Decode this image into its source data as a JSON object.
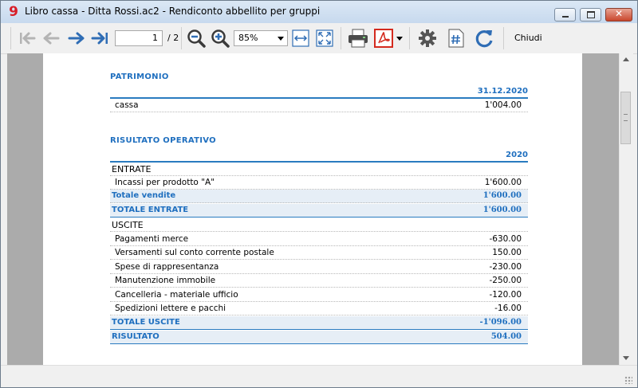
{
  "window": {
    "title": "Libro cassa - Ditta Rossi.ac2 - Rendiconto abbellito per gruppi",
    "app_icon_glyph": "9",
    "close_glyph": "✕"
  },
  "toolbar": {
    "current_page": "1",
    "page_total": "/ 2",
    "zoom": "85%",
    "close_label": "Chiudi",
    "icons": [
      "first-page-icon",
      "previous-page-icon",
      "next-page-icon",
      "last-page-icon",
      "zoom-out-icon",
      "zoom-in-icon",
      "fit-width-icon",
      "fit-page-icon",
      "print-icon",
      "pdf-icon",
      "settings-icon",
      "page-number-icon",
      "refresh-icon"
    ]
  },
  "report": {
    "patrimonio": {
      "title": "PATRIMONIO",
      "column_header": "31.12.2020",
      "rows": [
        {
          "label": "cassa",
          "amount": "1'004.00"
        }
      ]
    },
    "risultato": {
      "title": "RISULTATO OPERATIVO",
      "column_header": "2020",
      "entrate_label": "ENTRATE",
      "entrate_rows": [
        {
          "label": "Incassi per prodotto \"A\"",
          "amount": "1'600.00"
        }
      ],
      "totale_vendite": {
        "label": "Totale vendite",
        "amount": "1'600.00"
      },
      "totale_entrate": {
        "label": "TOTALE ENTRATE",
        "amount": "1'600.00"
      },
      "uscite_label": "USCITE",
      "uscite_rows": [
        {
          "label": "Pagamenti merce",
          "amount": "-630.00"
        },
        {
          "label": "Versamenti sul conto corrente postale",
          "amount": "150.00"
        },
        {
          "label": "Spese di rappresentanza",
          "amount": "-230.00"
        },
        {
          "label": "Manutenzione immobile",
          "amount": "-250.00"
        },
        {
          "label": "Cancelleria - materiale ufficio",
          "amount": "-120.00"
        },
        {
          "label": "Spedizioni lettere e pacchi",
          "amount": "-16.00"
        }
      ],
      "totale_uscite": {
        "label": "TOTALE USCITE",
        "amount": "-1'096.00"
      },
      "risultato": {
        "label": "RISULTATO",
        "amount": "504.00"
      }
    }
  },
  "colors": {
    "accent": "#1f6fbf",
    "total_row_bg": "#e6eef6",
    "pdf_red": "#d42a1e"
  }
}
